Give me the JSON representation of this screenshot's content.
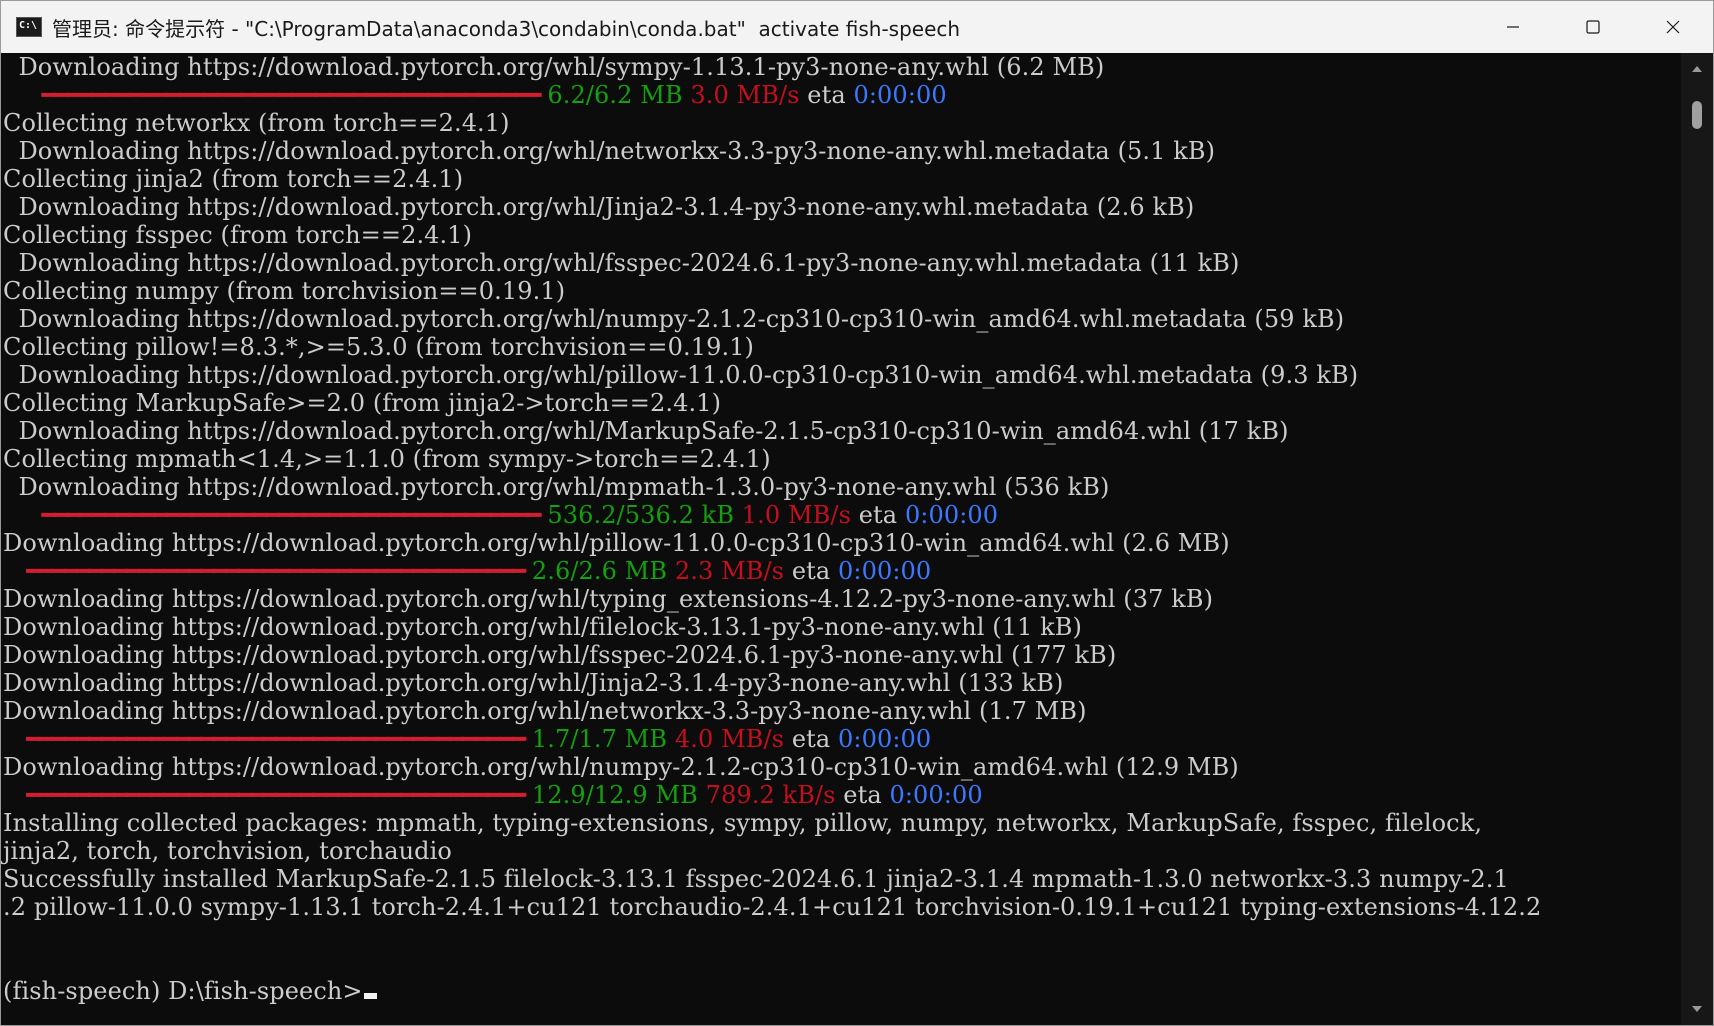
{
  "window": {
    "title": "管理员: 命令提示符 - \"C:\\ProgramData\\anaconda3\\condabin\\conda.bat\"  activate fish-speech",
    "icon_label": "C:\\"
  },
  "terminal": {
    "lines": [
      [
        {
          "t": "  Downloading https://download.pytorch.org/whl/sympy-1.13.1-py3-none-any.whl (6.2 MB)",
          "c": "default"
        }
      ],
      [
        {
          "t": "     ",
          "c": "default"
        },
        {
          "t": "━━━━━━━━━━━━━━━━━━━━━━━━━━━━━━━━━━━━━━━━",
          "c": "bar"
        },
        {
          "t": " 6.2/6.2 MB",
          "c": "green"
        },
        {
          "t": " 3.0 MB/s",
          "c": "red"
        },
        {
          "t": " eta ",
          "c": "default"
        },
        {
          "t": "0:00:00",
          "c": "blue"
        }
      ],
      [
        {
          "t": "Collecting networkx (from torch==2.4.1)",
          "c": "default"
        }
      ],
      [
        {
          "t": "  Downloading https://download.pytorch.org/whl/networkx-3.3-py3-none-any.whl.metadata (5.1 kB)",
          "c": "default"
        }
      ],
      [
        {
          "t": "Collecting jinja2 (from torch==2.4.1)",
          "c": "default"
        }
      ],
      [
        {
          "t": "  Downloading https://download.pytorch.org/whl/Jinja2-3.1.4-py3-none-any.whl.metadata (2.6 kB)",
          "c": "default"
        }
      ],
      [
        {
          "t": "Collecting fsspec (from torch==2.4.1)",
          "c": "default"
        }
      ],
      [
        {
          "t": "  Downloading https://download.pytorch.org/whl/fsspec-2024.6.1-py3-none-any.whl.metadata (11 kB)",
          "c": "default"
        }
      ],
      [
        {
          "t": "Collecting numpy (from torchvision==0.19.1)",
          "c": "default"
        }
      ],
      [
        {
          "t": "  Downloading https://download.pytorch.org/whl/numpy-2.1.2-cp310-cp310-win_amd64.whl.metadata (59 kB)",
          "c": "default"
        }
      ],
      [
        {
          "t": "Collecting pillow!=8.3.*,>=5.3.0 (from torchvision==0.19.1)",
          "c": "default"
        }
      ],
      [
        {
          "t": "  Downloading https://download.pytorch.org/whl/pillow-11.0.0-cp310-cp310-win_amd64.whl.metadata (9.3 kB)",
          "c": "default"
        }
      ],
      [
        {
          "t": "Collecting MarkupSafe>=2.0 (from jinja2->torch==2.4.1)",
          "c": "default"
        }
      ],
      [
        {
          "t": "  Downloading https://download.pytorch.org/whl/MarkupSafe-2.1.5-cp310-cp310-win_amd64.whl (17 kB)",
          "c": "default"
        }
      ],
      [
        {
          "t": "Collecting mpmath<1.4,>=1.1.0 (from sympy->torch==2.4.1)",
          "c": "default"
        }
      ],
      [
        {
          "t": "  Downloading https://download.pytorch.org/whl/mpmath-1.3.0-py3-none-any.whl (536 kB)",
          "c": "default"
        }
      ],
      [
        {
          "t": "     ",
          "c": "default"
        },
        {
          "t": "━━━━━━━━━━━━━━━━━━━━━━━━━━━━━━━━━━━━━━━━",
          "c": "bar"
        },
        {
          "t": " 536.2/536.2 kB",
          "c": "green"
        },
        {
          "t": " 1.0 MB/s",
          "c": "red"
        },
        {
          "t": " eta ",
          "c": "default"
        },
        {
          "t": "0:00:00",
          "c": "blue"
        }
      ],
      [
        {
          "t": "Downloading https://download.pytorch.org/whl/pillow-11.0.0-cp310-cp310-win_amd64.whl (2.6 MB)",
          "c": "default"
        }
      ],
      [
        {
          "t": "   ",
          "c": "default"
        },
        {
          "t": "━━━━━━━━━━━━━━━━━━━━━━━━━━━━━━━━━━━━━━━━",
          "c": "bar"
        },
        {
          "t": " 2.6/2.6 MB",
          "c": "green"
        },
        {
          "t": " 2.3 MB/s",
          "c": "red"
        },
        {
          "t": " eta ",
          "c": "default"
        },
        {
          "t": "0:00:00",
          "c": "blue"
        }
      ],
      [
        {
          "t": "Downloading https://download.pytorch.org/whl/typing_extensions-4.12.2-py3-none-any.whl (37 kB)",
          "c": "default"
        }
      ],
      [
        {
          "t": "Downloading https://download.pytorch.org/whl/filelock-3.13.1-py3-none-any.whl (11 kB)",
          "c": "default"
        }
      ],
      [
        {
          "t": "Downloading https://download.pytorch.org/whl/fsspec-2024.6.1-py3-none-any.whl (177 kB)",
          "c": "default"
        }
      ],
      [
        {
          "t": "Downloading https://download.pytorch.org/whl/Jinja2-3.1.4-py3-none-any.whl (133 kB)",
          "c": "default"
        }
      ],
      [
        {
          "t": "Downloading https://download.pytorch.org/whl/networkx-3.3-py3-none-any.whl (1.7 MB)",
          "c": "default"
        }
      ],
      [
        {
          "t": "   ",
          "c": "default"
        },
        {
          "t": "━━━━━━━━━━━━━━━━━━━━━━━━━━━━━━━━━━━━━━━━",
          "c": "bar"
        },
        {
          "t": " 1.7/1.7 MB",
          "c": "green"
        },
        {
          "t": " 4.0 MB/s",
          "c": "red"
        },
        {
          "t": " eta ",
          "c": "default"
        },
        {
          "t": "0:00:00",
          "c": "blue"
        }
      ],
      [
        {
          "t": "Downloading https://download.pytorch.org/whl/numpy-2.1.2-cp310-cp310-win_amd64.whl (12.9 MB)",
          "c": "default"
        }
      ],
      [
        {
          "t": "   ",
          "c": "default"
        },
        {
          "t": "━━━━━━━━━━━━━━━━━━━━━━━━━━━━━━━━━━━━━━━━",
          "c": "bar"
        },
        {
          "t": " 12.9/12.9 MB",
          "c": "green"
        },
        {
          "t": " 789.2 kB/s",
          "c": "red"
        },
        {
          "t": " eta ",
          "c": "default"
        },
        {
          "t": "0:00:00",
          "c": "blue"
        }
      ],
      [
        {
          "t": "Installing collected packages: mpmath, typing-extensions, sympy, pillow, numpy, networkx, MarkupSafe, fsspec, filelock,",
          "c": "default"
        }
      ],
      [
        {
          "t": "jinja2, torch, torchvision, torchaudio",
          "c": "default"
        }
      ],
      [
        {
          "t": "Successfully installed MarkupSafe-2.1.5 filelock-3.13.1 fsspec-2024.6.1 jinja2-3.1.4 mpmath-1.3.0 networkx-3.3 numpy-2.1",
          "c": "default"
        }
      ],
      [
        {
          "t": ".2 pillow-11.0.0 sympy-1.13.1 torch-2.4.1+cu121 torchaudio-2.4.1+cu121 torchvision-0.19.1+cu121 typing-extensions-4.12.2",
          "c": "default"
        }
      ],
      [
        {
          "t": "",
          "c": "default"
        }
      ],
      [
        {
          "t": "",
          "c": "default"
        }
      ]
    ],
    "prompt": "(fish-speech) D:\\fish-speech>"
  },
  "colors": {
    "background": "#0c0c0c",
    "default_text": "#cccccc",
    "progress_bar": "#d11f2f",
    "size_green": "#13a10e",
    "speed_red": "#c50f1f",
    "eta_blue": "#3b78ff"
  },
  "icons": {
    "app": "cmd-icon",
    "minimize": "minimize-icon",
    "maximize": "maximize-icon",
    "close": "close-icon",
    "scroll_up": "scroll-up-arrow-icon",
    "scroll_down": "scroll-down-arrow-icon"
  }
}
